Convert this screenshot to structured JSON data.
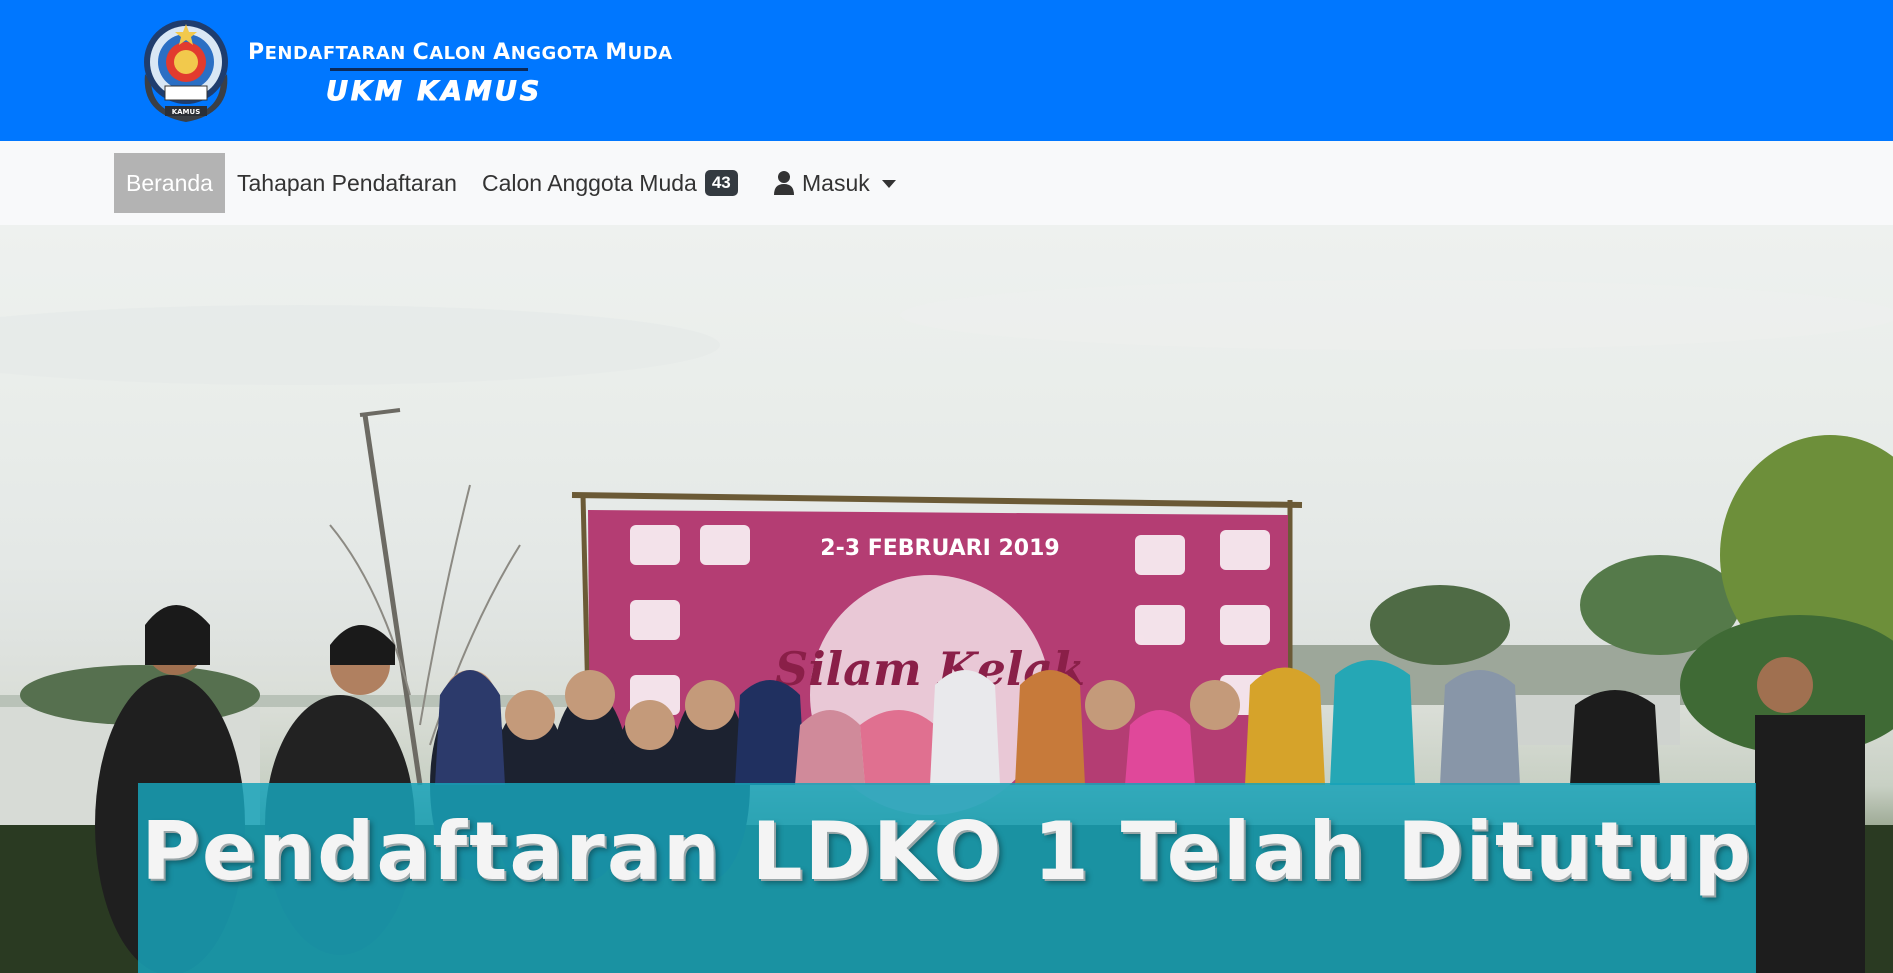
{
  "header": {
    "title_prefix_1": "P",
    "title_rest_1": "ENDAFTARAN ",
    "title_prefix_2": "C",
    "title_rest_2": "ALON ",
    "title_prefix_3": "A",
    "title_rest_3": "NGGOTA ",
    "title_prefix_4": "M",
    "title_rest_4": "UDA",
    "subtitle": "UKM KAMUS",
    "logo_icon": "ukm-kamus-emblem",
    "logo_ring_text": "KAMUS",
    "bar_color": "#0077ff"
  },
  "nav": {
    "home": "Beranda",
    "stages": "Tahapan Pendaftaran",
    "candidates": "Calon Anggota Muda",
    "candidates_count": "43",
    "login": "Masuk",
    "login_icon": "user-icon",
    "dropdown_icon": "caret-down-icon"
  },
  "hero": {
    "banner_date": "2-3 FEBRUARI 2019",
    "banner_brand": "Silam Kelak",
    "caption": "Pendaftaran LDKO 1 Telah Ditutup",
    "caption_bg": "#17a2b8"
  }
}
